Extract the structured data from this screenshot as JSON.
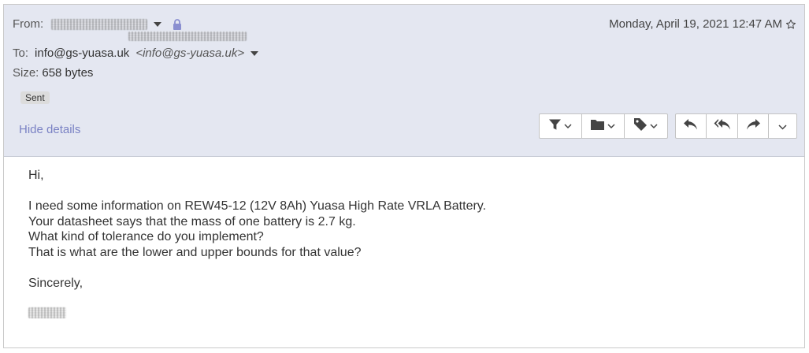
{
  "header": {
    "from_label": "From:",
    "date": "Monday, April 19, 2021 12:47 AM",
    "to_label": "To:",
    "to_address": "info@gs-yuasa.uk",
    "to_address_angle": "<info@gs-yuasa.uk>",
    "size_label": "Size:",
    "size_value": "658 bytes",
    "badge": "Sent",
    "hide_details": "Hide details"
  },
  "toolbar": {
    "group1": [
      {
        "icon": "filter-icon"
      },
      {
        "icon": "folder-icon"
      },
      {
        "icon": "tag-icon"
      }
    ],
    "group2": [
      {
        "icon": "reply-icon"
      },
      {
        "icon": "reply-all-icon"
      },
      {
        "icon": "forward-icon"
      },
      {
        "icon": "more-chevron-icon"
      }
    ]
  },
  "message": {
    "greeting": "Hi,",
    "line1": "I need some information on REW45-12 (12V 8Ah) Yuasa High Rate VRLA Battery.",
    "line2": "Your datasheet says that the mass of one battery is 2.7 kg.",
    "line3": "What kind of tolerance do you implement?",
    "line4": "That is what are the lower and upper bounds for that value?",
    "closing": "Sincerely,"
  },
  "colors": {
    "header_bg": "#e4e7f1",
    "link": "#7a82c4",
    "lock": "#8a8fd0"
  }
}
